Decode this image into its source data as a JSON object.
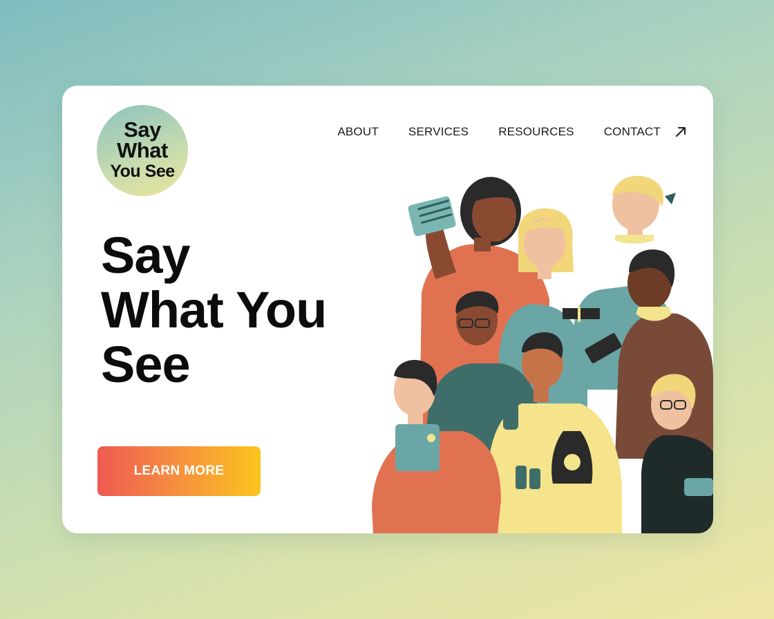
{
  "logo": {
    "line1": "Say",
    "line2": "What",
    "line3": "You See"
  },
  "nav": {
    "items": [
      {
        "label": "ABOUT"
      },
      {
        "label": "SERVICES"
      },
      {
        "label": "RESOURCES"
      },
      {
        "label": "CONTACT"
      }
    ],
    "external_icon": "arrow-up-right-icon"
  },
  "hero": {
    "title_line1": "Say",
    "title_line2": "What You",
    "title_line3": "See",
    "cta_label": "LEARN MORE"
  },
  "colors": {
    "cta_gradient_start": "#ef5a52",
    "cta_gradient_end": "#fbc51c",
    "logo_gradient_start": "#8cc3bf",
    "logo_gradient_end": "#e9e49c",
    "text_dark": "#0c0c0c"
  }
}
